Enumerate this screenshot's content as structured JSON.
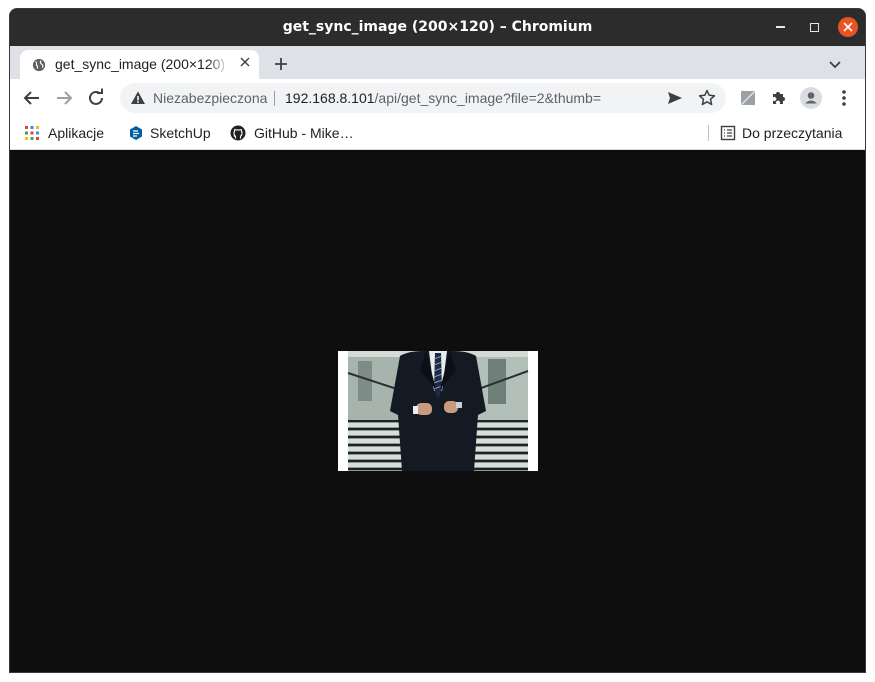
{
  "window": {
    "title": "get_sync_image (200×120) – Chromium"
  },
  "tab": {
    "label": "get_sync_image (200×120)",
    "close_glyph": "✕"
  },
  "new_tab_glyph": "+",
  "address": {
    "security_label": "Niezabezpieczona",
    "host": "192.168.8.101",
    "path": "/api/get_sync_image?file=2&thumb="
  },
  "bookmarks": {
    "items": [
      {
        "label": "Aplikacje",
        "icon": "apps-grid-icon"
      },
      {
        "label": "SketchUp",
        "icon": "sketchup-icon"
      },
      {
        "label": "GitHub - Mike…",
        "icon": "github-icon"
      }
    ],
    "reading_list": "Do przeczytania"
  },
  "image": {
    "width": 200,
    "height": 120,
    "description_icon": "businessman-suit-photo"
  },
  "colors": {
    "titlebar": "#2c2c2c",
    "close_button": "#e95420",
    "content_bg": "#0e0e0e",
    "tabstrip": "#dee1e6"
  }
}
